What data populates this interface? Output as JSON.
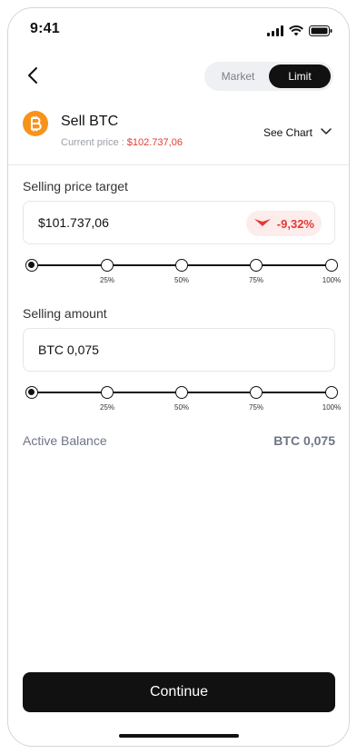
{
  "status": {
    "time": "9:41"
  },
  "mode": {
    "options": [
      "Market",
      "Limit"
    ],
    "selected": "Limit"
  },
  "asset": {
    "title": "Sell BTC",
    "current_price_label": "Current price :",
    "current_price_value": "$102.737,06",
    "see_chart": "See Chart",
    "coin_icon": "bitcoin-icon",
    "accent": "#f7931a"
  },
  "price_target": {
    "label": "Selling price target",
    "value": "$101.737,06",
    "change": "-9,32%",
    "change_color": "#e53935",
    "slider": {
      "ticks": [
        "25%",
        "50%",
        "75%",
        "100%"
      ],
      "selected_percent": 0
    }
  },
  "amount": {
    "label": "Selling amount",
    "value": "BTC 0,075",
    "slider": {
      "ticks": [
        "25%",
        "50%",
        "75%",
        "100%"
      ],
      "selected_percent": 0
    }
  },
  "balance": {
    "label": "Active Balance",
    "value": "BTC 0,075"
  },
  "continue_label": "Continue"
}
